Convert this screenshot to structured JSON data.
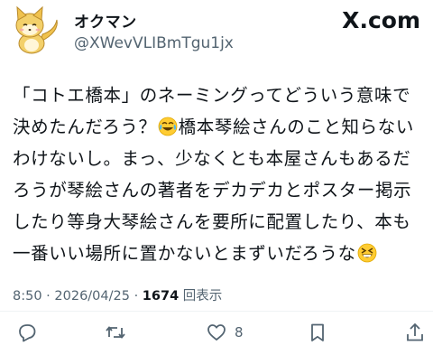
{
  "header": {
    "display_name": "オクマン",
    "handle": "@XWevVLIBmTgu1jx",
    "brand": "X.com",
    "avatar_icon": "fox-avatar-icon"
  },
  "tweet": {
    "line1": "「コトエ橋本」のネーミングってどういう意味で",
    "line2_a": "決めたんだろう？",
    "line2_emoji": "face-with-tears-of-joy",
    "line2_b": "橋本琴絵さんのこと知らない",
    "line3": "わけないし。まっ、少なくとも本屋さんもあるだ",
    "line4": "ろうが琴絵さんの著者をデカデカとポスター掲示",
    "line5": "したり等身大琴絵さんを要所に配置したり、本も",
    "line6_a": "一番いい場所に置かないとまずいだろうな",
    "line6_emoji": "grinning-squinting-face"
  },
  "meta": {
    "time": "8:50",
    "separator": "·",
    "date": "2026/04/25",
    "views": "1674",
    "views_label": "回表示"
  },
  "actions": {
    "reply_icon": "reply-icon",
    "retweet_icon": "retweet-icon",
    "like_icon": "heart-icon",
    "like_count": "8",
    "bookmark_icon": "bookmark-icon",
    "share_icon": "share-icon"
  },
  "colors": {
    "text": "#0f1419",
    "secondary": "#536471",
    "divider": "#eff3f4",
    "avatar_fox": "#f0c24e"
  }
}
